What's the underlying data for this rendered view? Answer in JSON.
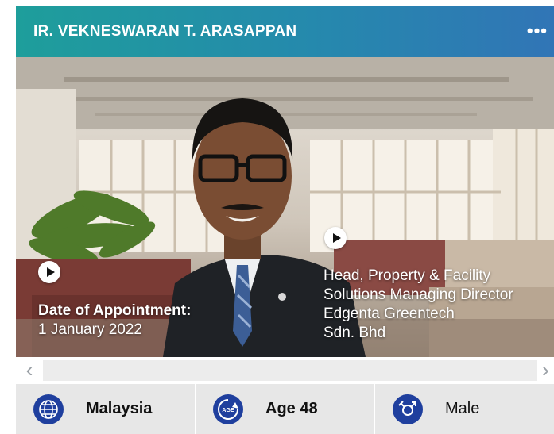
{
  "profile": {
    "name": "IR. VEKNESWARAN T. ARASAPPAN",
    "menu_glyph": "•••",
    "date_label": "Date of Appointment:",
    "date_value": "1 January 2022",
    "role_lines": [
      "Head, Property & Facility",
      "Solutions Managing Director",
      "Edgenta Greentech",
      "Sdn. Bhd"
    ]
  },
  "scroll": {
    "left": "‹",
    "right": "›"
  },
  "stats": {
    "country": "Malaysia",
    "age": "Age 48",
    "age_icon_text": "AGE",
    "gender": "Male"
  },
  "colors": {
    "header_start": "#1e9e9b",
    "header_end": "#3175b6",
    "icon_bg": "#1f3f9e",
    "stats_bg": "#e7e7e7"
  },
  "icons": [
    "globe-icon",
    "age-icon",
    "gender-icon",
    "play-icon"
  ]
}
